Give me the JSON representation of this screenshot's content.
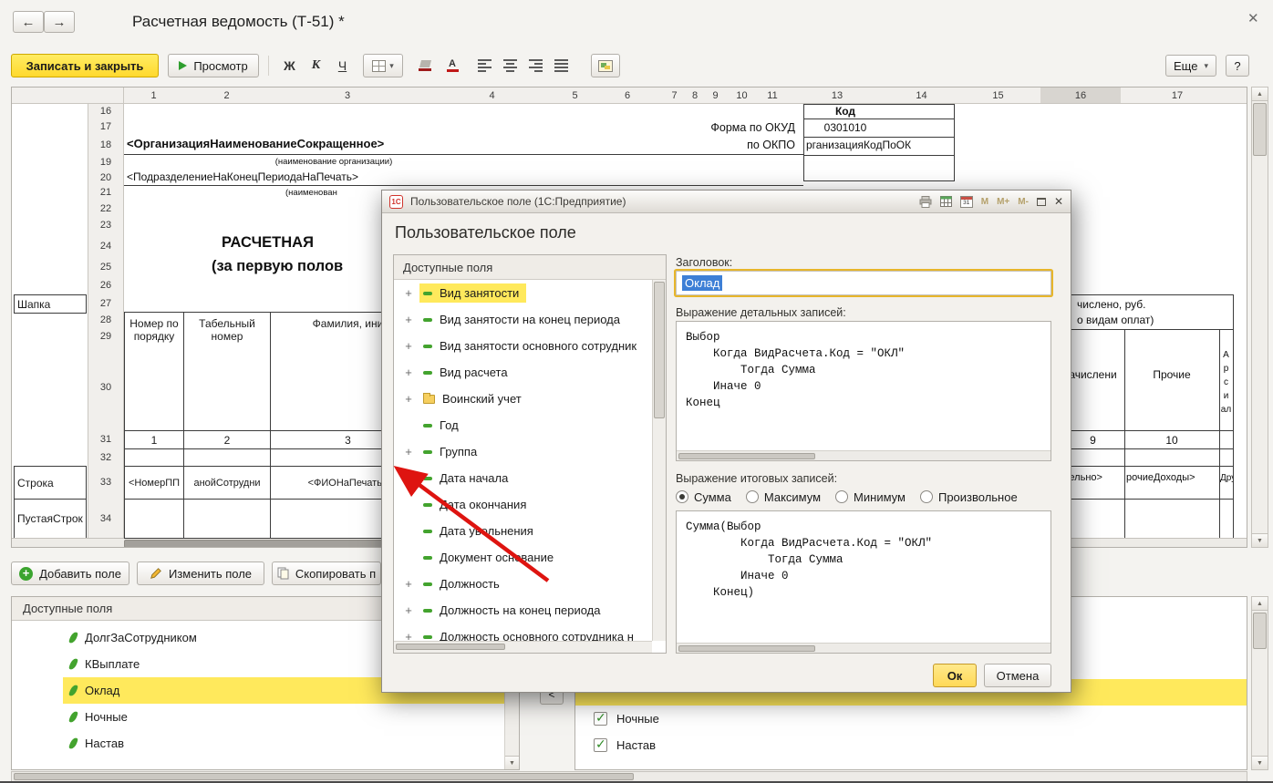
{
  "titlebar": {
    "title": "Расчетная ведомость (Т-51) *"
  },
  "toolbar": {
    "save_close": "Записать и закрыть",
    "preview": "Просмотр",
    "bold": "Ж",
    "italic": "К",
    "underline": "Ч",
    "font_color_letter": "А",
    "more": "Еще",
    "help": "?"
  },
  "sheet": {
    "columns": [
      "1",
      "2",
      "3",
      "4",
      "5",
      "6",
      "7",
      "8",
      "9",
      "10",
      "11",
      "13",
      "14",
      "15",
      "16",
      "17"
    ],
    "selected_column": "16",
    "rows": [
      "16",
      "17",
      "18",
      "19",
      "20",
      "21",
      "22",
      "23",
      "24",
      "25",
      "26",
      "27",
      "28",
      "29",
      "30",
      "31",
      "32",
      "33",
      "34"
    ],
    "side_labels": {
      "header_zone": "Шапка",
      "row_zone": "Строка",
      "empty_zone": "ПустаяСтрок"
    },
    "cells": {
      "kod_header": "Код",
      "forma_po_okud": "Форма по ОКУД",
      "okud_code": "0301010",
      "po_okpo": "по ОКПО",
      "okpo_value": "рганизацияКодПоОК",
      "org_name": "<ОрганизацияНаименованиеСокращенное>",
      "org_caption": "(наименование организации)",
      "division": "<ПодразделениеНаКонецПериодаНаПечать>",
      "division_caption": "(наименован",
      "doc_title_line1": "РАСЧЕТНАЯ",
      "doc_title_line2": "(за первую полов",
      "col1_header": "Номер по порядку",
      "col2_header": "Табельный номер",
      "col3_header": "Фамилия, ини",
      "num_row": [
        "1",
        "2",
        "3"
      ],
      "num_9": "9",
      "num_10": "10",
      "row_cells": [
        "<НомерПП",
        "анойСотрудни",
        "<ФИОНаПечать>"
      ],
      "row_cells_right": [
        "дельно>",
        "рочиеДоходы>",
        "Дру"
      ],
      "right_caption_1": "числено, руб.",
      "right_caption_2": "о видам оплат)",
      "right_col13": "ачислени",
      "right_col14": "Прочие",
      "narrow_letters": [
        "А",
        "р",
        "с",
        "и",
        "ал"
      ]
    }
  },
  "actions": {
    "add_field": "Добавить поле",
    "edit_field": "Изменить поле",
    "copy_field": "Скопировать п"
  },
  "fields_panel": {
    "header": "Доступные поля",
    "items": [
      {
        "label": "ДолгЗаСотрудником",
        "selected": false
      },
      {
        "label": "КВыплате",
        "selected": false
      },
      {
        "label": "Оклад",
        "selected": true
      },
      {
        "label": "Ночные",
        "selected": false
      },
      {
        "label": "Настав",
        "selected": false
      }
    ]
  },
  "right_panel": {
    "collapse": "<",
    "items": [
      {
        "label": "Ночные",
        "checked": true
      },
      {
        "label": "Настав",
        "checked": true
      }
    ]
  },
  "dialog": {
    "title": "Пользовательское поле  (1С:Предприятие)",
    "window_buttons": {
      "calendar": "31",
      "m": "М",
      "m_plus": "М+",
      "m_minus": "М-"
    },
    "heading": "Пользовательское поле",
    "tree_header": "Доступные поля",
    "tree": [
      {
        "label": "Вид занятости",
        "icon": "field",
        "expandable": true,
        "selected": true
      },
      {
        "label": "Вид занятости на конец периода",
        "icon": "field",
        "expandable": true,
        "selected": false
      },
      {
        "label": "Вид занятости основного сотрудник",
        "icon": "field",
        "expandable": true,
        "selected": false
      },
      {
        "label": "Вид расчета",
        "icon": "field",
        "expandable": true,
        "selected": false
      },
      {
        "label": "Воинский учет",
        "icon": "folder",
        "expandable": true,
        "selected": false
      },
      {
        "label": "Год",
        "icon": "field",
        "expandable": false,
        "selected": false
      },
      {
        "label": "Группа",
        "icon": "field",
        "expandable": true,
        "selected": false
      },
      {
        "label": "Дата начала",
        "icon": "field",
        "expandable": true,
        "selected": false
      },
      {
        "label": "Дата окончания",
        "icon": "field",
        "expandable": false,
        "selected": false
      },
      {
        "label": "Дата увольнения",
        "icon": "field",
        "expandable": false,
        "selected": false
      },
      {
        "label": "Документ основание",
        "icon": "field",
        "expandable": false,
        "selected": false
      },
      {
        "label": "Должность",
        "icon": "field",
        "expandable": true,
        "selected": false
      },
      {
        "label": "Должность на конец периода",
        "icon": "field",
        "expandable": true,
        "selected": false
      },
      {
        "label": "Должность основного сотрудника н",
        "icon": "field",
        "expandable": true,
        "selected": false
      }
    ],
    "title_label": "Заголовок:",
    "title_value": "Оклад",
    "detail_label": "Выражение детальных записей:",
    "detail_code": "Выбор\n    Когда ВидРасчета.Код = \"ОКЛ\"\n        Тогда Сумма\n    Иначе 0\nКонец",
    "total_label": "Выражение итоговых записей:",
    "total_options": [
      {
        "label": "Сумма",
        "checked": true
      },
      {
        "label": "Максимум",
        "checked": false
      },
      {
        "label": "Минимум",
        "checked": false
      },
      {
        "label": "Произвольное",
        "checked": false
      }
    ],
    "total_code": "Сумма(Выбор\n        Когда ВидРасчета.Код = \"ОКЛ\"\n            Тогда Сумма\n        Иначе 0\n    Конец)",
    "ok": "Ок",
    "cancel": "Отмена"
  },
  "colors": {
    "accent_yellow": "#ffd92e",
    "selection_yellow": "#ffe95c",
    "selection_blue": "#3d7fd6",
    "arrow_red": "#de1410",
    "icon_green": "#43a32e"
  }
}
